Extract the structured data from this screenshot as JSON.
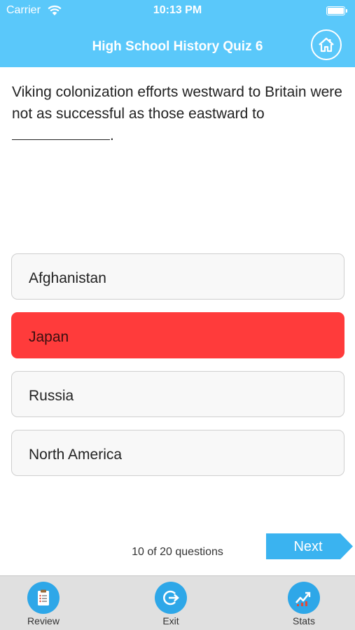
{
  "status_bar": {
    "carrier": "Carrier",
    "time": "10:13 PM"
  },
  "nav": {
    "title": "High School History Quiz 6",
    "home_icon": "home-icon"
  },
  "question": {
    "text": "Viking colonization efforts westward to Britain were not as successful as those eastward to",
    "trailing": "."
  },
  "answers": [
    {
      "label": "Afghanistan",
      "selected": false
    },
    {
      "label": "Japan",
      "selected": true
    },
    {
      "label": "Russia",
      "selected": false
    },
    {
      "label": "North America",
      "selected": false
    }
  ],
  "colors": {
    "accent": "#5ac8fa",
    "selected": "#ff3b3b",
    "tab_icon": "#2ea7e8",
    "next": "#3ab3f0"
  },
  "progress": {
    "text": "10 of 20 questions",
    "current": 10,
    "total": 20
  },
  "next": {
    "label": "Next"
  },
  "tabbar": {
    "items": [
      {
        "label": "Review",
        "icon": "review-icon"
      },
      {
        "label": "Exit",
        "icon": "exit-icon"
      },
      {
        "label": "Stats",
        "icon": "stats-icon"
      }
    ]
  }
}
